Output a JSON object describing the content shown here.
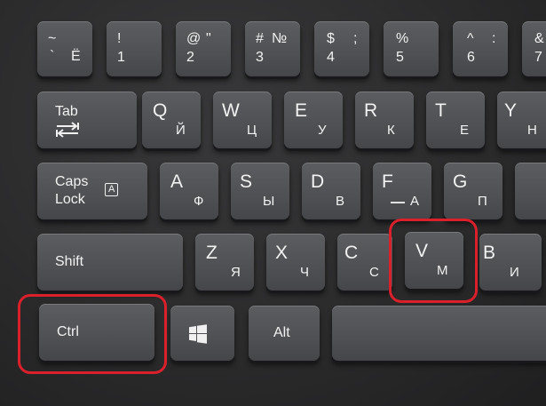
{
  "keyboard": {
    "row_numbers": {
      "tilde": {
        "top": "~",
        "mid": "`",
        "cyr": "Ё"
      },
      "k1": {
        "top": "!",
        "main": "1"
      },
      "k2": {
        "top": "@",
        "quote": "\"",
        "main": "2"
      },
      "k3": {
        "top": "#",
        "alt": "№",
        "main": "3"
      },
      "k4": {
        "top": "$",
        "alt": ";",
        "main": "4"
      },
      "k5": {
        "top": "%",
        "main": "5"
      },
      "k6": {
        "top": "^",
        "alt": ":",
        "main": "6"
      },
      "k7": {
        "top": "&",
        "alt": "?",
        "main": "7"
      }
    },
    "row_q": {
      "tab": "Tab",
      "q": {
        "lat": "Q",
        "cyr": "Й"
      },
      "w": {
        "lat": "W",
        "cyr": "Ц"
      },
      "e": {
        "lat": "E",
        "cyr": "У"
      },
      "r": {
        "lat": "R",
        "cyr": "К"
      },
      "t": {
        "lat": "T",
        "cyr": "Е"
      },
      "y": {
        "lat": "Y",
        "cyr": "Н"
      }
    },
    "row_a": {
      "caps_line1": "Caps",
      "caps_line2": "Lock",
      "caps_icon": "A",
      "a": {
        "lat": "A",
        "cyr": "Ф"
      },
      "s": {
        "lat": "S",
        "cyr": "Ы"
      },
      "d": {
        "lat": "D",
        "cyr": "В"
      },
      "f": {
        "lat": "F",
        "cyr": "А"
      },
      "g": {
        "lat": "G",
        "cyr": "П"
      }
    },
    "row_z": {
      "shift": "Shift",
      "z": {
        "lat": "Z",
        "cyr": "Я"
      },
      "x": {
        "lat": "X",
        "cyr": "Ч"
      },
      "c": {
        "lat": "C",
        "cyr": "С"
      },
      "v": {
        "lat": "V",
        "cyr": "М"
      },
      "b": {
        "lat": "B",
        "cyr": "И"
      }
    },
    "row_bottom": {
      "ctrl": "Ctrl",
      "win": "windows-logo",
      "alt": "Alt",
      "space": ""
    },
    "highlight_color": "#d9202b",
    "highlighted_keys": [
      "Ctrl",
      "V"
    ]
  }
}
